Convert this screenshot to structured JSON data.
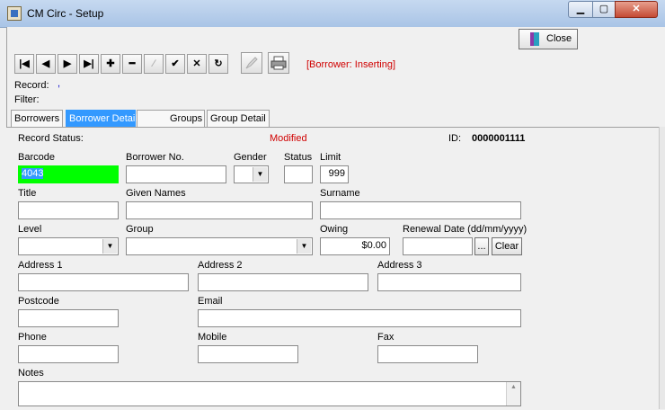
{
  "window": {
    "title": "CM Circ - Setup",
    "min_glyph": "▁",
    "max_glyph": "▢",
    "close_glyph": "✕"
  },
  "toolbar": {
    "first": "|◀",
    "prev": "◀",
    "next": "▶",
    "last": "▶|",
    "add": "✚",
    "delete": "━",
    "edit": "∕",
    "post": "✔",
    "cancel": "✕",
    "refresh": "↻",
    "status": "[Borrower: Inserting]"
  },
  "close_button": {
    "label": "Close"
  },
  "record": {
    "record_label": "Record:",
    "record_value": ",",
    "filter_label": "Filter:"
  },
  "tabs": [
    "Borrowers",
    "Borrower Detail",
    "Groups",
    "Group Detail"
  ],
  "form": {
    "record_status_label": "Record Status:",
    "record_status_value": "Modified",
    "id_label": "ID:",
    "id_value": "0000001111",
    "barcode_label": "Barcode",
    "barcode_value": "4043",
    "borrower_no_label": "Borrower No.",
    "borrower_no_value": "",
    "gender_label": "Gender",
    "gender_value": "",
    "status_label": "Status",
    "status_value": "",
    "limit_label": "Limit",
    "limit_value": "999",
    "title_label": "Title",
    "title_value": "",
    "given_names_label": "Given Names",
    "given_names_value": "",
    "surname_label": "Surname",
    "surname_value": "",
    "level_label": "Level",
    "level_value": "",
    "group_label": "Group",
    "group_value": "",
    "owing_label": "Owing",
    "owing_value": "$0.00",
    "renewal_label": "Renewal Date (dd/mm/yyyy)",
    "renewal_value": "",
    "ellipsis_label": "...",
    "clear_label": "Clear",
    "address1_label": "Address 1",
    "address1_value": "",
    "address2_label": "Address 2",
    "address2_value": "",
    "address3_label": "Address 3",
    "address3_value": "",
    "postcode_label": "Postcode",
    "postcode_value": "",
    "email_label": "Email",
    "email_value": "",
    "phone_label": "Phone",
    "phone_value": "",
    "mobile_label": "Mobile",
    "mobile_value": "",
    "fax_label": "Fax",
    "fax_value": "",
    "notes_label": "Notes",
    "notes_value": ""
  },
  "colors": {
    "barcode_highlight": "#00ff00",
    "status_red": "#d00000",
    "active_tab": "#3399ff"
  }
}
